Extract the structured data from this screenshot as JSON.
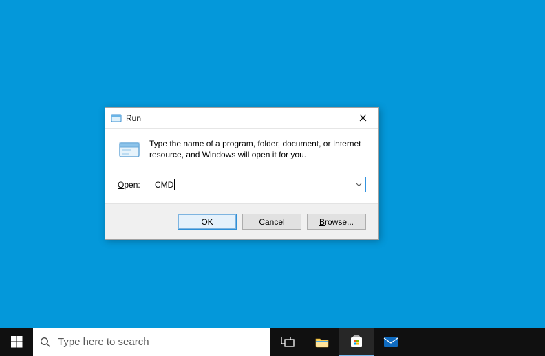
{
  "dialog": {
    "title": "Run",
    "description": "Type the name of a program, folder, document, or Internet resource, and Windows will open it for you.",
    "open_label": "Open:",
    "open_accesskey": "O",
    "input_value": "CMD",
    "buttons": {
      "ok": "OK",
      "cancel": "Cancel",
      "browse": "Browse...",
      "browse_accesskey": "B"
    }
  },
  "taskbar": {
    "search_placeholder": "Type here to search"
  }
}
